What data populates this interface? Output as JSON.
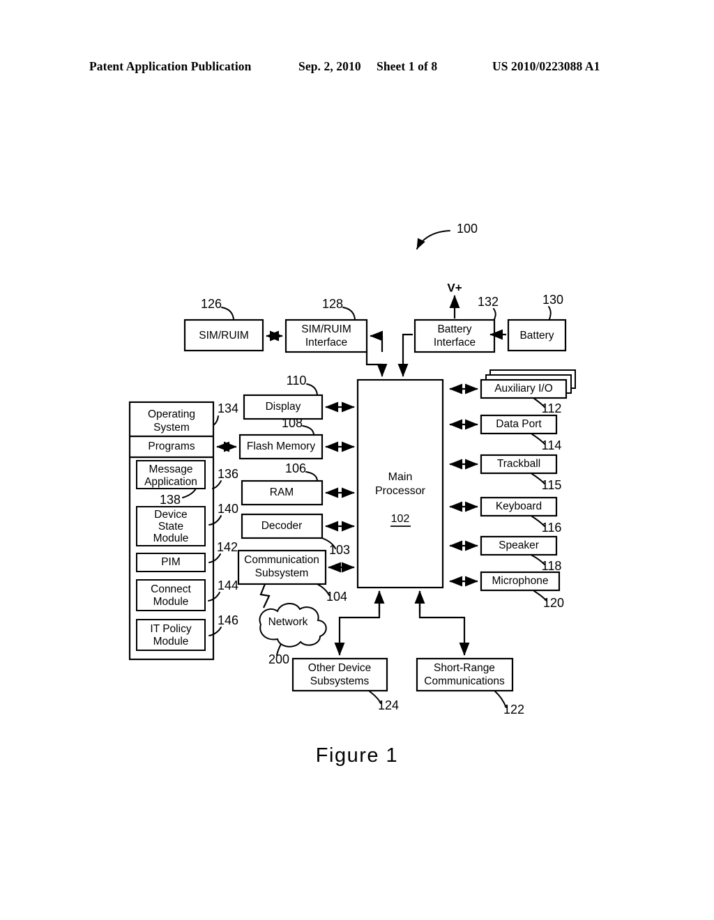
{
  "header": {
    "publication": "Patent Application Publication",
    "date": "Sep. 2, 2010",
    "sheet": "Sheet 1 of 8",
    "number": "US 2010/0223088 A1"
  },
  "figure": {
    "caption": "Figure 1",
    "system_ref": "100",
    "power_label": "V+"
  },
  "top_row": {
    "sim_ruim": {
      "label": "SIM/RUIM",
      "ref": "126"
    },
    "sim_ruim_interface": {
      "label_line1": "SIM/RUIM",
      "label_line2": "Interface",
      "ref": "128"
    },
    "battery_interface": {
      "label_line1": "Battery",
      "label_line2": "Interface",
      "ref": "132"
    },
    "battery": {
      "label": "Battery",
      "ref": "130"
    }
  },
  "software_panel": {
    "operating_system": {
      "label_line1": "Operating",
      "label_line2": "System",
      "ref": "134"
    },
    "programs": {
      "label": "Programs",
      "ref": "136"
    },
    "modules": [
      {
        "label_line1": "Message",
        "label_line2": "Application",
        "ref": "138"
      },
      {
        "label_line1": "Device",
        "label_line2": "State",
        "label_line3": "Module",
        "ref": "140"
      },
      {
        "label_line1": "PIM",
        "label_line2": "",
        "ref": "142"
      },
      {
        "label_line1": "Connect",
        "label_line2": "Module",
        "ref": "144"
      },
      {
        "label_line1": "IT Policy",
        "label_line2": "Module",
        "ref": "146"
      }
    ]
  },
  "middle_column": [
    {
      "name": "display",
      "label_line1": "Display",
      "label_line2": "",
      "ref": "110"
    },
    {
      "name": "flash-memory",
      "label_line1": "Flash Memory",
      "label_line2": "",
      "ref": "108"
    },
    {
      "name": "ram",
      "label_line1": "RAM",
      "label_line2": "",
      "ref": "106"
    },
    {
      "name": "decoder",
      "label_line1": "Decoder",
      "label_line2": "",
      "ref": "103"
    },
    {
      "name": "communication-subsystem",
      "label_line1": "Communication",
      "label_line2": "Subsystem",
      "ref": "104"
    }
  ],
  "processor": {
    "label_line1": "Main",
    "label_line2": "Processor",
    "ref": "102"
  },
  "network": {
    "label": "Network",
    "ref": "200"
  },
  "right_column": [
    {
      "name": "auxiliary-io",
      "label": "Auxiliary I/O",
      "ref": "112",
      "stacked": true
    },
    {
      "name": "data-port",
      "label": "Data Port",
      "ref": "114",
      "stacked": false
    },
    {
      "name": "trackball",
      "label": "Trackball",
      "ref": "115",
      "stacked": false
    },
    {
      "name": "keyboard",
      "label": "Keyboard",
      "ref": "116",
      "stacked": false
    },
    {
      "name": "speaker",
      "label": "Speaker",
      "ref": "118",
      "stacked": false
    },
    {
      "name": "microphone",
      "label": "Microphone",
      "ref": "120",
      "stacked": false
    }
  ],
  "bottom_row": {
    "other_device_subsystems": {
      "label_line1": "Other Device",
      "label_line2": "Subsystems",
      "ref": "124"
    },
    "short_range_communications": {
      "label_line1": "Short-Range",
      "label_line2": "Communications",
      "ref": "122"
    }
  }
}
